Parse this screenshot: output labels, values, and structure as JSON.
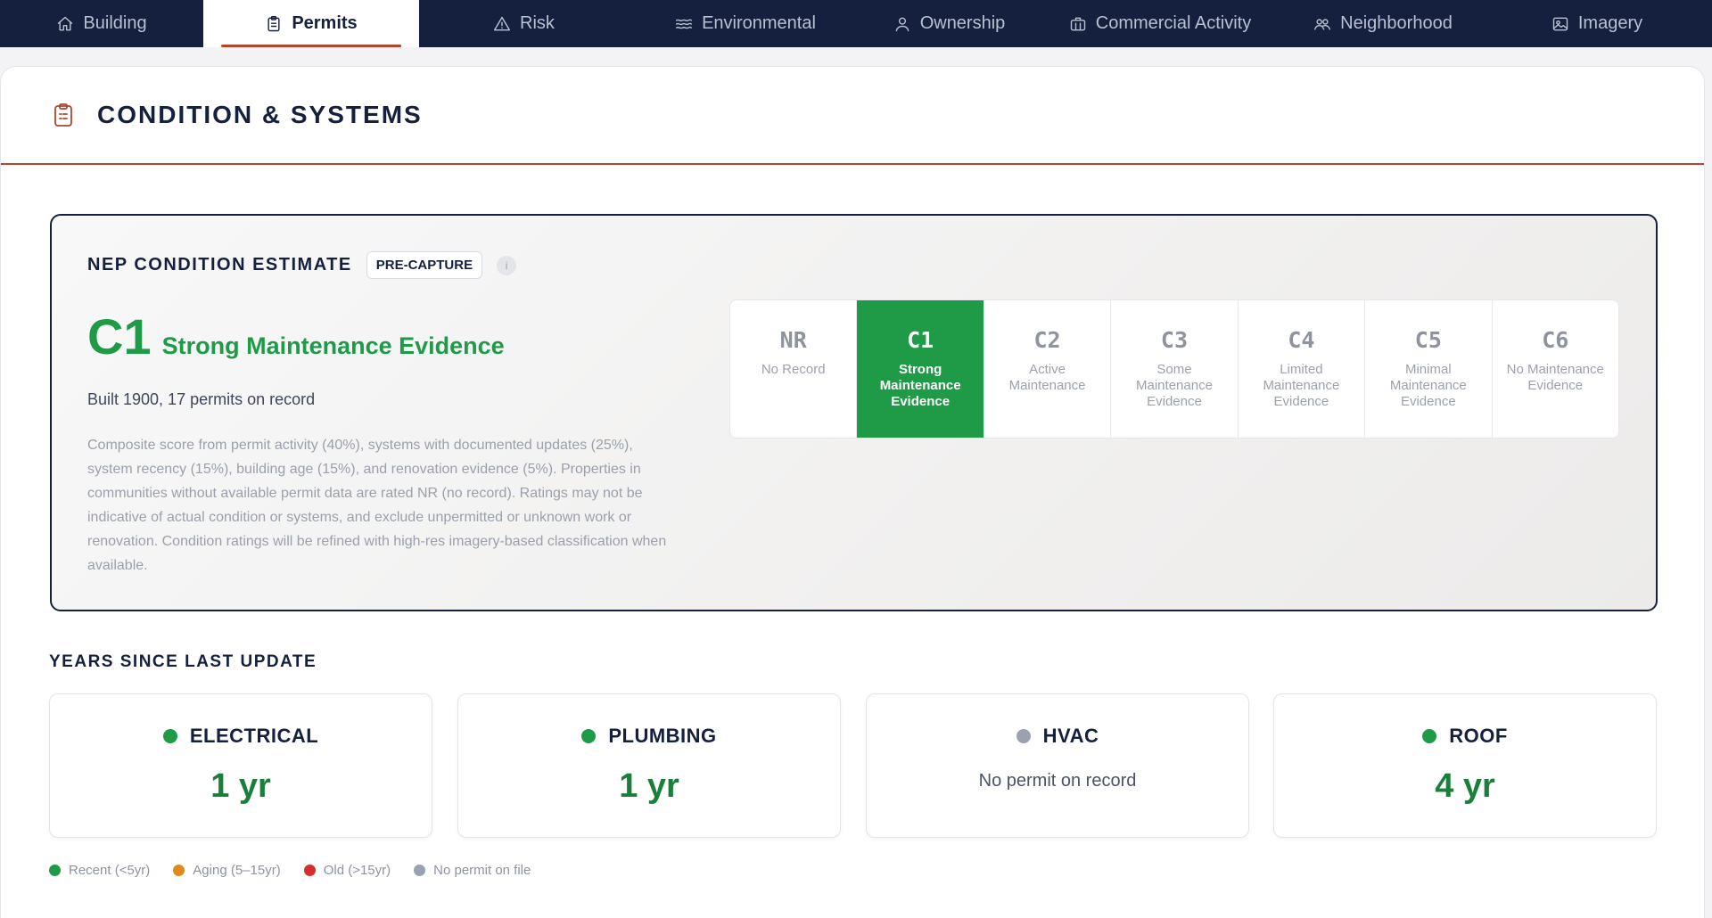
{
  "nav": {
    "tabs": [
      {
        "label": "Building",
        "icon": "home-icon"
      },
      {
        "label": "Permits",
        "icon": "clipboard-icon",
        "active": true
      },
      {
        "label": "Risk",
        "icon": "warning-icon"
      },
      {
        "label": "Environmental",
        "icon": "waves-icon"
      },
      {
        "label": "Ownership",
        "icon": "person-icon"
      },
      {
        "label": "Commercial Activity",
        "icon": "briefcase-icon"
      },
      {
        "label": "Neighborhood",
        "icon": "people-icon"
      },
      {
        "label": "Imagery",
        "icon": "image-icon"
      }
    ]
  },
  "section": {
    "title": "CONDITION & SYSTEMS",
    "icon": "clipboard-icon",
    "accent": "#b3432e"
  },
  "estimate": {
    "title": "NEP CONDITION ESTIMATE",
    "badge": "PRE-CAPTURE",
    "info": "i",
    "grade_code": "C1",
    "grade_label": "Strong Maintenance Evidence",
    "built_line": "Built 1900, 17 permits on record",
    "description": "Composite score from permit activity (40%), systems with documented updates (25%), system recency (15%), building age (15%), and renovation evidence (5%). Properties in communities without available permit data are rated NR (no record). Ratings may not be indicative of actual condition or systems, and exclude unpermitted or unknown work or renovation. Condition ratings will be refined with high-res imagery-based classification when available.",
    "scale": [
      {
        "code": "NR",
        "label": "No Record"
      },
      {
        "code": "C1",
        "label": "Strong Maintenance Evidence",
        "active": true
      },
      {
        "code": "C2",
        "label": "Active Maintenance"
      },
      {
        "code": "C3",
        "label": "Some Maintenance Evidence"
      },
      {
        "code": "C4",
        "label": "Limited Maintenance Evidence"
      },
      {
        "code": "C5",
        "label": "Minimal Maintenance Evidence"
      },
      {
        "code": "C6",
        "label": "No Maintenance Evidence"
      }
    ],
    "accent": "#1f9b48"
  },
  "years": {
    "title": "YEARS SINCE LAST UPDATE",
    "systems": [
      {
        "name": "ELECTRICAL",
        "value": "1 yr",
        "status_color": "#1f9b48"
      },
      {
        "name": "PLUMBING",
        "value": "1 yr",
        "status_color": "#1f9b48"
      },
      {
        "name": "HVAC",
        "value": "No permit on record",
        "status_color": "#9aa1b0"
      },
      {
        "name": "ROOF",
        "value": "4 yr",
        "status_color": "#1f9b48"
      }
    ],
    "legend": [
      {
        "label": "Recent (<5yr)",
        "color": "#1f9b48"
      },
      {
        "label": "Aging (5–15yr)",
        "color": "#e08a1e"
      },
      {
        "label": "Old (>15yr)",
        "color": "#d92c2c"
      },
      {
        "label": "No permit on file",
        "color": "#9aa1b0"
      }
    ]
  }
}
